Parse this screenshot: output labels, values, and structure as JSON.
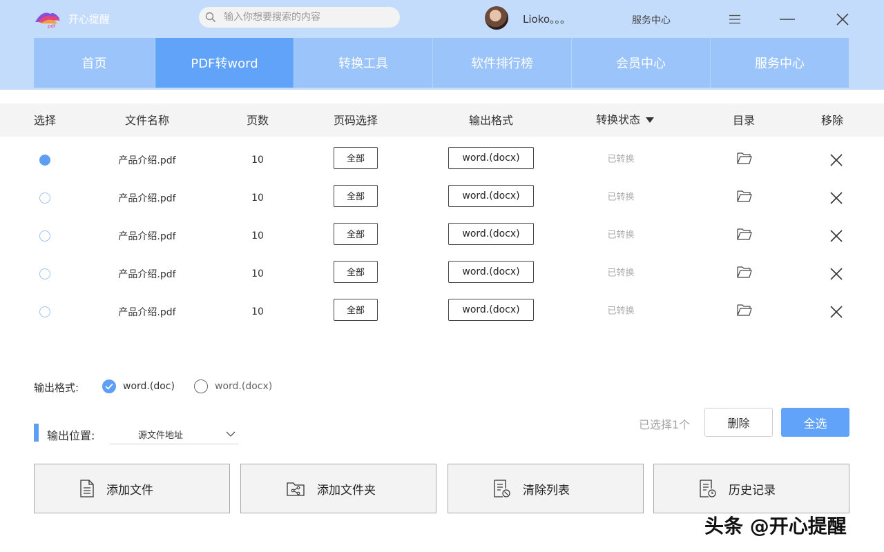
{
  "header": {
    "app_name": "开心提醒",
    "logo_text": "pdf",
    "search_placeholder": "输入你想要搜索的内容",
    "username": "Lioko。。。",
    "service_center": "服务中心"
  },
  "nav": {
    "tabs": [
      {
        "label": "首页"
      },
      {
        "label": "PDF转word"
      },
      {
        "label": "转换工具"
      },
      {
        "label": "软件排行榜"
      },
      {
        "label": "会员中心"
      },
      {
        "label": "服务中心"
      }
    ],
    "active_index": 1
  },
  "table": {
    "headers": [
      "选择",
      "文件名称",
      "页数",
      "页码选择",
      "输出格式",
      "转换状态",
      "目录",
      "移除"
    ],
    "rows": [
      {
        "selected": true,
        "file_name": "产品介绍.pdf",
        "pages": "10",
        "page_select": "全部",
        "format": "word.(docx)",
        "status": "已转换"
      },
      {
        "selected": false,
        "file_name": "产品介绍.pdf",
        "pages": "10",
        "page_select": "全部",
        "format": "word.(docx)",
        "status": "已转换"
      },
      {
        "selected": false,
        "file_name": "产品介绍.pdf",
        "pages": "10",
        "page_select": "全部",
        "format": "word.(docx)",
        "status": "已转换"
      },
      {
        "selected": false,
        "file_name": "产品介绍.pdf",
        "pages": "10",
        "page_select": "全部",
        "format": "word.(docx)",
        "status": "已转换"
      },
      {
        "selected": false,
        "file_name": "产品介绍.pdf",
        "pages": "10",
        "page_select": "全部",
        "format": "word.(docx)",
        "status": "已转换"
      }
    ]
  },
  "output_format": {
    "label": "输出格式:",
    "options": [
      {
        "label": "word.(doc)",
        "checked": true
      },
      {
        "label": "word.(docx)",
        "checked": false
      }
    ]
  },
  "output_location": {
    "label": "输出位置:",
    "value": "源文件地址"
  },
  "selection": {
    "count_text": "已选择1个",
    "delete_label": "删除",
    "select_all_label": "全选"
  },
  "actions": {
    "add_file": "添加文件",
    "add_folder": "添加文件夹",
    "clear_list": "清除列表",
    "history": "历史记录"
  },
  "watermark": "头条 @开心提醒",
  "colors": {
    "header_bg": "#c4dcfb",
    "tab_bg": "#9bc4fa",
    "tab_active": "#62a3fa",
    "accent": "#5f9ef5"
  }
}
